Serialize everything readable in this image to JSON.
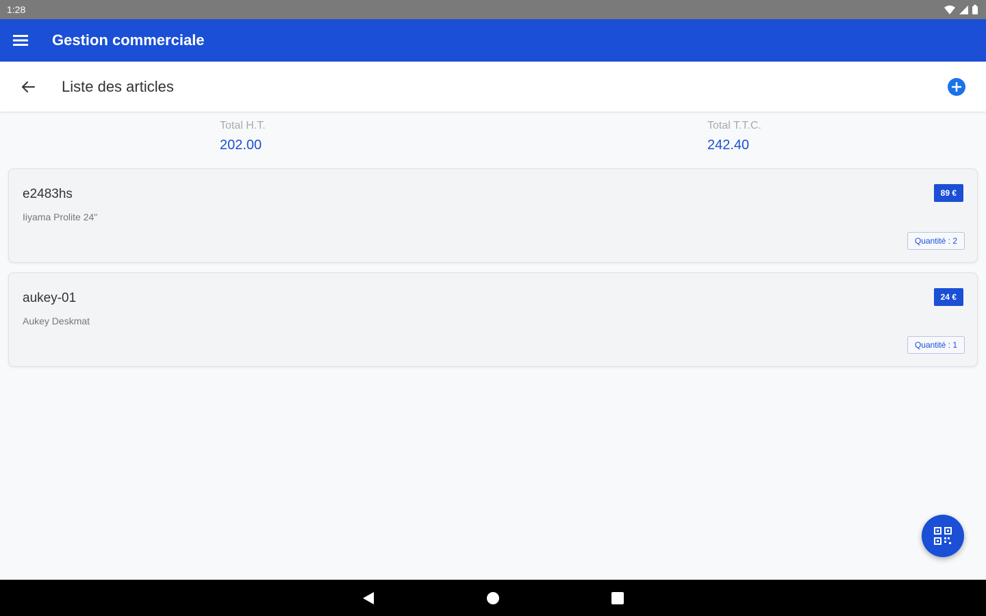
{
  "status_bar": {
    "time": "1:28"
  },
  "app_bar": {
    "title": "Gestion commerciale"
  },
  "sub_bar": {
    "title": "Liste des articles"
  },
  "totals": {
    "ht_label": "Total H.T.",
    "ht_value": "202.00",
    "ttc_label": "Total T.T.C.",
    "ttc_value": "242.40"
  },
  "articles": [
    {
      "code": "e2483hs",
      "description": "Iiyama Prolite 24\"",
      "price": "89 €",
      "quantity": "Quantité : 2"
    },
    {
      "code": "aukey-01",
      "description": "Aukey Deskmat",
      "price": "24 €",
      "quantity": "Quantité : 1"
    }
  ],
  "icons": {
    "menu": "menu-icon",
    "back": "arrow-back-icon",
    "add": "add-circle-icon",
    "qr": "qr-code-icon"
  },
  "colors": {
    "primary": "#1a4fd6",
    "accent": "#1a73e8",
    "status_bar": "#7a7a7a"
  }
}
